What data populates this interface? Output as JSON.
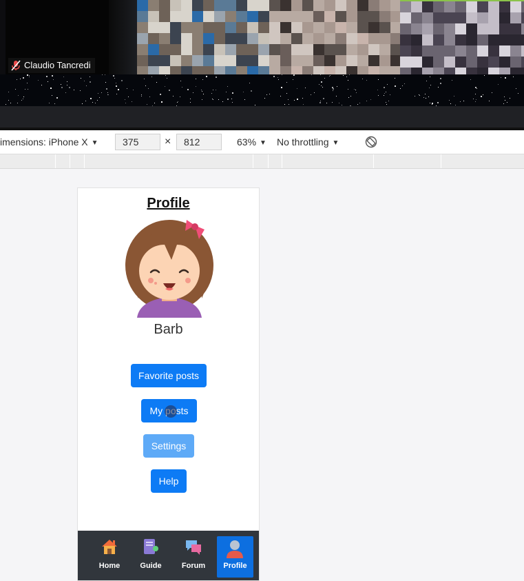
{
  "video_call": {
    "local_participant": "Claudio Tancredi"
  },
  "devtools": {
    "dimensions_label": "imensions: iPhone X",
    "width": "375",
    "times": "×",
    "height": "812",
    "zoom": "63%",
    "throttling": "No throttling",
    "caret": "▼"
  },
  "profile": {
    "title": "Profile",
    "user_name": "Barb",
    "buttons": {
      "favorite": "Favorite posts",
      "my_posts": "My posts",
      "settings": "Settings",
      "help": "Help"
    }
  },
  "bottom_nav": [
    {
      "label": "Home"
    },
    {
      "label": "Guide"
    },
    {
      "label": "Forum"
    },
    {
      "label": "Profile",
      "active": true
    }
  ],
  "colors": {
    "primary": "#0d7bf5",
    "primary_disabled": "#5eaaf7",
    "nav_bg": "#31363c",
    "nav_active": "#0d6fe0"
  }
}
